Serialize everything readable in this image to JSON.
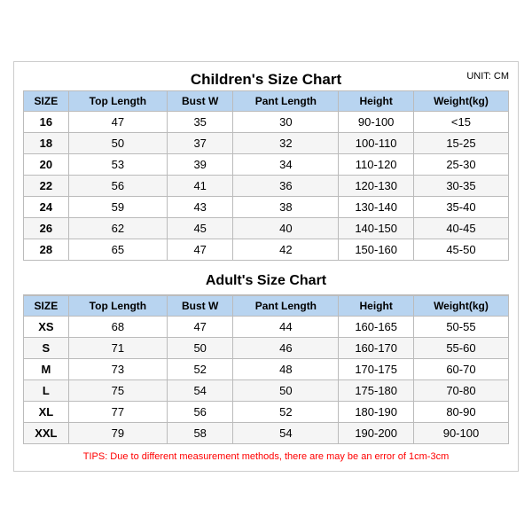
{
  "page": {
    "unit": "UNIT: CM",
    "children_title": "Children's Size Chart",
    "adult_title": "Adult's Size Chart",
    "tips": "TIPS: Due to different measurement methods, there are may be an error of 1cm-3cm",
    "columns": [
      "SIZE",
      "Top Length",
      "Bust W",
      "Pant Length",
      "Height",
      "Weight(kg)"
    ],
    "children_rows": [
      [
        "16",
        "47",
        "35",
        "30",
        "90-100",
        "<15"
      ],
      [
        "18",
        "50",
        "37",
        "32",
        "100-110",
        "15-25"
      ],
      [
        "20",
        "53",
        "39",
        "34",
        "110-120",
        "25-30"
      ],
      [
        "22",
        "56",
        "41",
        "36",
        "120-130",
        "30-35"
      ],
      [
        "24",
        "59",
        "43",
        "38",
        "130-140",
        "35-40"
      ],
      [
        "26",
        "62",
        "45",
        "40",
        "140-150",
        "40-45"
      ],
      [
        "28",
        "65",
        "47",
        "42",
        "150-160",
        "45-50"
      ]
    ],
    "adult_rows": [
      [
        "XS",
        "68",
        "47",
        "44",
        "160-165",
        "50-55"
      ],
      [
        "S",
        "71",
        "50",
        "46",
        "160-170",
        "55-60"
      ],
      [
        "M",
        "73",
        "52",
        "48",
        "170-175",
        "60-70"
      ],
      [
        "L",
        "75",
        "54",
        "50",
        "175-180",
        "70-80"
      ],
      [
        "XL",
        "77",
        "56",
        "52",
        "180-190",
        "80-90"
      ],
      [
        "XXL",
        "79",
        "58",
        "54",
        "190-200",
        "90-100"
      ]
    ]
  }
}
